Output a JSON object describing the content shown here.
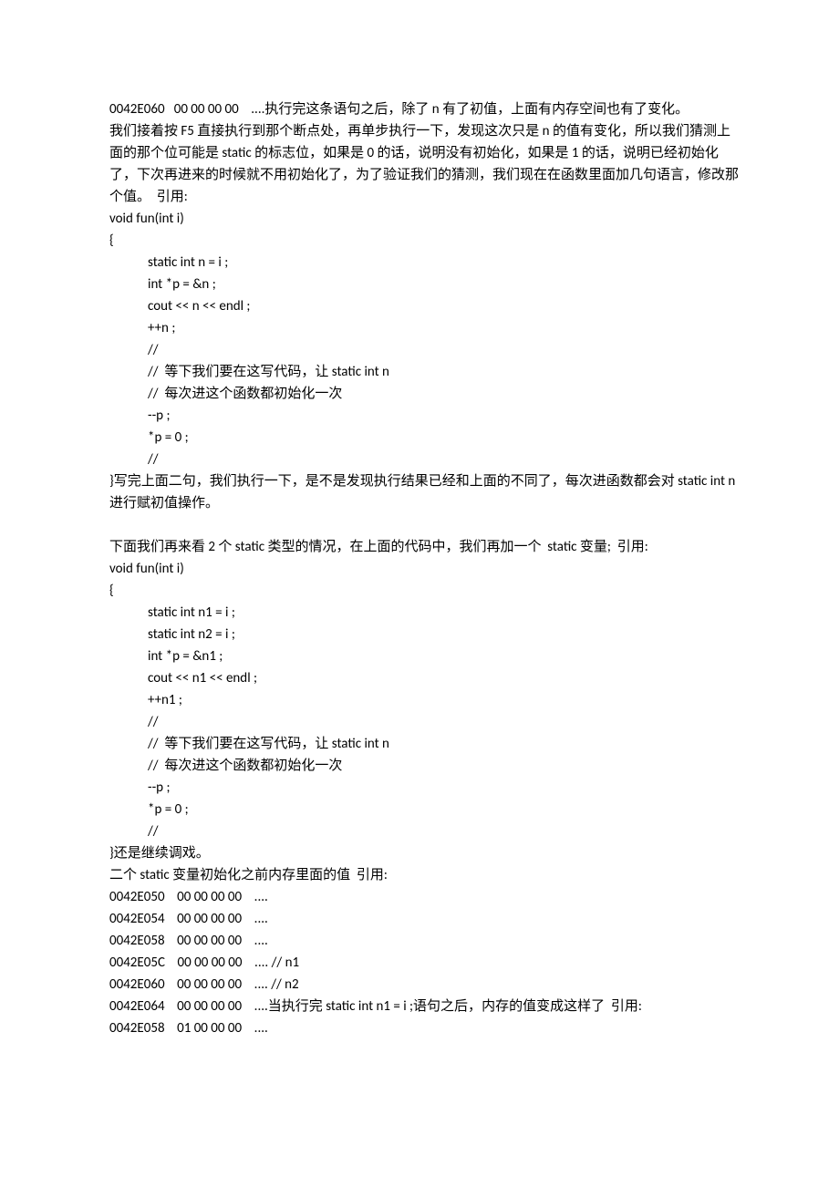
{
  "p": {
    "l1": "0042E060   00 00 00 00    ....执行完这条语句之后，除了 n 有了初值，上面有内存空间也有了变化。",
    "l2": "我们接着按 F5 直接执行到那个断点处，再单步执行一下，发现这次只是 n 的值有变化，所以我们猜测上面的那个位可能是 static 的标志位，如果是 0 的话，说明没有初始化，如果是 1 的话，说明已经初始化了，下次再进来的时候就不用初始化了，为了验证我们的猜测，我们现在在函数里面加几句语言，修改那个值。  引用:",
    "l3": "void fun(int i)",
    "l4": "{",
    "l5": "static int n = i ;",
    "l6": "int *p = &n ;",
    "l7": "cout << n << endl ;",
    "l8": "++n ;",
    "l9": "//",
    "l10": "//  等下我们要在这写代码，让 static int n",
    "l11": "//  每次进这个函数都初始化一次",
    "l12": "--p ;",
    "l13": "*p = 0 ;",
    "l14": "//",
    "l15": "}写完上面二句，我们执行一下，是不是发现执行结果已经和上面的不同了，每次进函数都会对 static int n 进行赋初值操作。",
    "l16": "下面我们再来看 2 个 static 类型的情况，在上面的代码中，我们再加一个  static 变量;  引用:",
    "l17": "void fun(int i)",
    "l18": "{",
    "l19": "static int n1 = i ;",
    "l20": "static int n2 = i ;",
    "l21": "int *p = &n1 ;",
    "l22": "cout << n1 << endl ;",
    "l23": "++n1 ;",
    "l24": "//",
    "l25": "//  等下我们要在这写代码，让 static int n",
    "l26": "//  每次进这个函数都初始化一次",
    "l27": "--p ;",
    "l28": "*p = 0 ;",
    "l29": "//",
    "l30": "}还是继续调戏。",
    "l31": "二个 static 变量初始化之前内存里面的值  引用:",
    "l32": "0042E050    00 00 00 00    ....",
    "l33": "0042E054    00 00 00 00    ....",
    "l34": "0042E058    00 00 00 00    ....",
    "l35": "0042E05C    00 00 00 00    .... // n1",
    "l36": "0042E060    00 00 00 00    .... // n2",
    "l37": "0042E064    00 00 00 00    ....当执行完 static int n1 = i ;语句之后，内存的值变成这样了  引用:",
    "l38": "0042E058    01 00 00 00    ...."
  }
}
